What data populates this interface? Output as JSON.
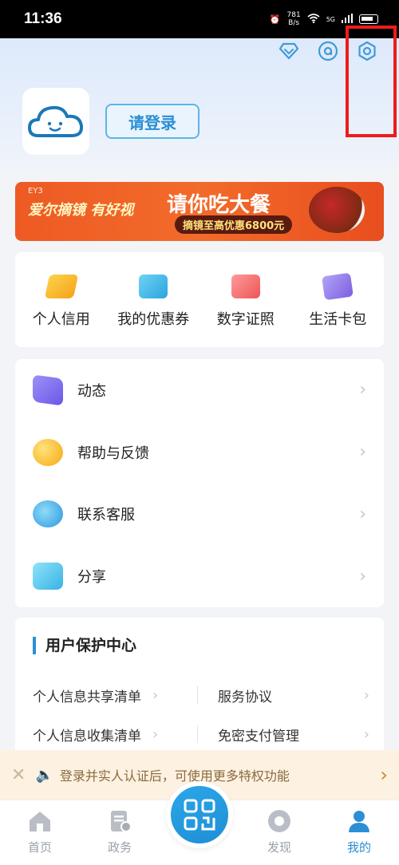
{
  "status_bar": {
    "time": "11:36",
    "speed_value": "781",
    "speed_unit": "B/s",
    "network": "5G"
  },
  "header": {
    "icons": [
      "diamond-icon",
      "chat-icon",
      "settings-icon"
    ],
    "login_label": "请登录"
  },
  "banner": {
    "brand": "EY3",
    "slogan": "爱尔摘镜 有好视",
    "title": "请你吃大餐",
    "subtitle": "摘镜至高优惠6800元"
  },
  "quick_actions": [
    {
      "label": "个人信用",
      "icon": "credit-icon",
      "color": "#f5b822"
    },
    {
      "label": "我的优惠券",
      "icon": "coupon-icon",
      "color": "#4dbce8"
    },
    {
      "label": "数字证照",
      "icon": "license-icon",
      "color": "#f06b6b"
    },
    {
      "label": "生活卡包",
      "icon": "wallet-icon",
      "color": "#8b73e6"
    }
  ],
  "menu": [
    {
      "label": "动态",
      "icon": "feed-icon",
      "color": "#7a6cf0"
    },
    {
      "label": "帮助与反馈",
      "icon": "help-icon",
      "color": "#f5b822"
    },
    {
      "label": "联系客服",
      "icon": "customer-service-icon",
      "color": "#3aa8e6"
    },
    {
      "label": "分享",
      "icon": "share-icon",
      "color": "#4dc4e8"
    }
  ],
  "protection": {
    "title": "用户保护中心",
    "items": [
      "个人信息共享清单",
      "服务协议",
      "个人信息收集清单",
      "免密支付管理"
    ]
  },
  "notice": {
    "text": "登录并实人认证后，可使用更多特权功能"
  },
  "nav": {
    "home": "首页",
    "gov": "政务",
    "discover": "发现",
    "mine": "我的"
  }
}
